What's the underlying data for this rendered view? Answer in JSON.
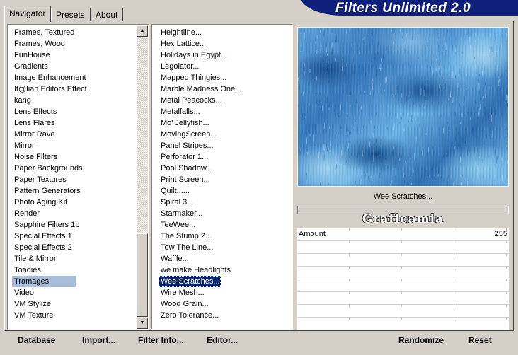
{
  "window": {
    "title": "Filters Unlimited 2.0"
  },
  "tabs": [
    {
      "label": "Navigator",
      "active": true
    },
    {
      "label": "Presets",
      "active": false
    },
    {
      "label": "About",
      "active": false
    }
  ],
  "categories": {
    "items": [
      "Frames, Textured",
      "Frames, Wood",
      "FunHouse",
      "Gradients",
      "Image Enhancement",
      "It@lian Editors Effect",
      "kang",
      "Lens Effects",
      "Lens Flares",
      "Mirror Rave",
      "Mirror",
      "Noise Filters",
      "Paper Backgrounds",
      "Paper Textures",
      "Pattern Generators",
      "Photo Aging Kit",
      "Render",
      "Sapphire Filters 1b",
      "Special Effects 1",
      "Special Effects 2",
      "Tile & Mirror",
      "Toadies",
      "Tramages",
      "Video",
      "VM Stylize",
      "VM Texture"
    ],
    "selected": "Tramages"
  },
  "filters": {
    "items": [
      "Heightline...",
      "Hex Lattice...",
      "Holidays in Egypt...",
      "Legolator...",
      "Mapped Thingies...",
      "Marble Madness One...",
      "Metal Peacocks...",
      "Metalfalls...",
      "Mo' Jellyfish...",
      "MovingScreen...",
      "Panel Stripes...",
      "Perforator 1...",
      "Pool Shadow...",
      "Print Screen...",
      "Quilt......",
      "Spiral 3...",
      "Starmaker...",
      "TeeWee...",
      "The Stump 2...",
      "Tow The Line...",
      "Waffle...",
      "we make Headlights",
      "Wee Scratches...",
      "Wire Mesh...",
      "Wood Grain...",
      "Zero Tolerance..."
    ],
    "selected": "Wee Scratches..."
  },
  "preview": {
    "filter_name": "Wee Scratches...",
    "watermark": "Graficamia",
    "progress": 0
  },
  "parameters": [
    {
      "name": "Amount",
      "value": "255"
    },
    {
      "name": "",
      "value": ""
    },
    {
      "name": "",
      "value": ""
    },
    {
      "name": "",
      "value": ""
    },
    {
      "name": "",
      "value": ""
    },
    {
      "name": "",
      "value": ""
    },
    {
      "name": "",
      "value": ""
    },
    {
      "name": "",
      "value": ""
    }
  ],
  "buttons": {
    "database": {
      "u": "D",
      "rest": "atabase"
    },
    "import": {
      "u": "I",
      "rest": "mport..."
    },
    "filter_info": {
      "pre": "Filter ",
      "u": "I",
      "rest": "nfo..."
    },
    "editor": {
      "u": "E",
      "rest": "ditor..."
    },
    "randomize": "Randomize",
    "reset": "Reset"
  },
  "colors": {
    "banner": "#10207a",
    "selection": "#0a246a",
    "category_highlight": "#a6bcd8",
    "face": "#d4d0c8"
  },
  "icons": {
    "scroll_up": "▲",
    "scroll_down": "▼"
  }
}
